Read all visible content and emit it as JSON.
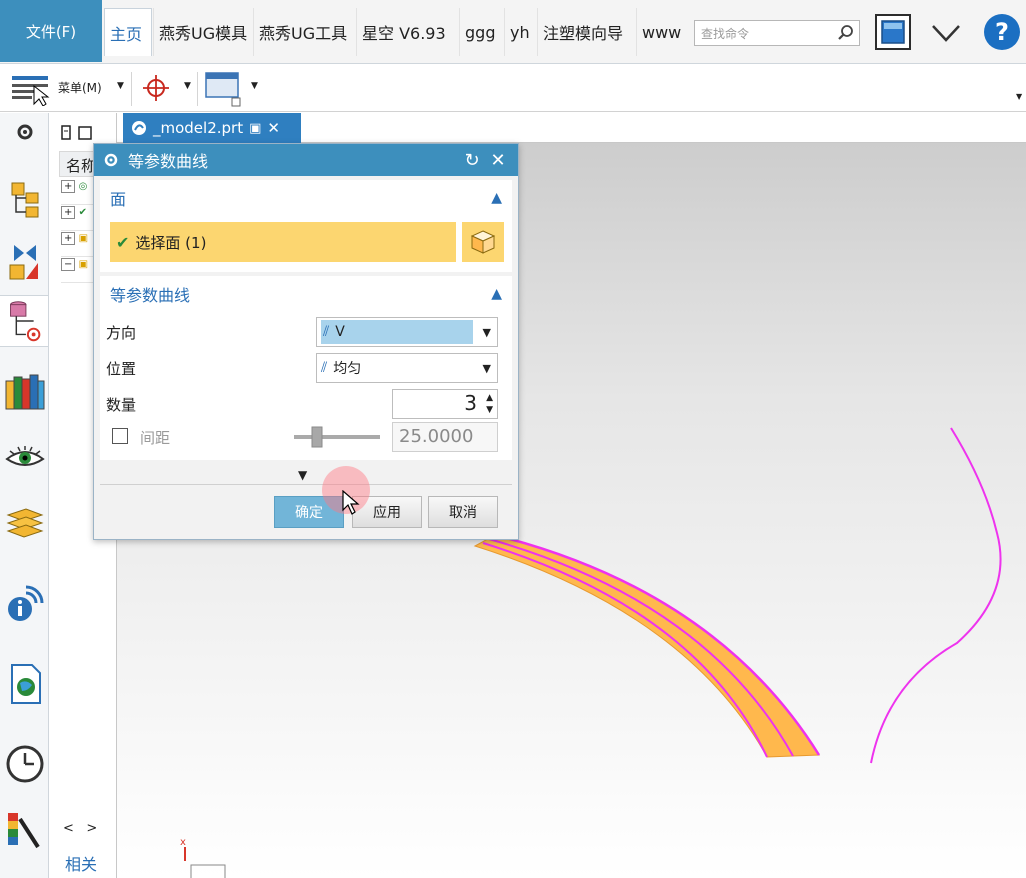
{
  "ribbon": {
    "file_label": "文件(F)",
    "tabs": [
      {
        "label": "主页",
        "active": true
      },
      {
        "label": "燕秀UG模具"
      },
      {
        "label": "燕秀UG工具"
      },
      {
        "label": "星空 V6.93"
      },
      {
        "label": "ggg"
      },
      {
        "label": "yh"
      },
      {
        "label": "注塑模向导"
      },
      {
        "label": "www"
      }
    ],
    "search_placeholder": "查找命令",
    "help_label": "?"
  },
  "toolbar": {
    "menu_label": "菜单(M)"
  },
  "nav_panel": {
    "header_label": "名称",
    "footer_label": "相关",
    "scroll_left": "<",
    "scroll_right": ">"
  },
  "document": {
    "tab_label": "_model2.prt"
  },
  "dialog": {
    "title": "等参数曲线",
    "section_face": {
      "title": "面",
      "select_label": "选择面 (1)"
    },
    "section_curve": {
      "title": "等参数曲线",
      "direction_label": "方向",
      "direction_value": "V",
      "position_label": "位置",
      "position_value": "均匀",
      "count_label": "数量",
      "count_value": "3",
      "spacing_label": "间距",
      "spacing_value": "25.0000"
    },
    "buttons": {
      "ok": "确定",
      "apply": "应用",
      "cancel": "取消"
    }
  },
  "colors": {
    "title_bar": "#3d8fbd",
    "selection_bg": "#fcd670",
    "curve": "#ee33ee",
    "surface": "#ffb84d"
  }
}
